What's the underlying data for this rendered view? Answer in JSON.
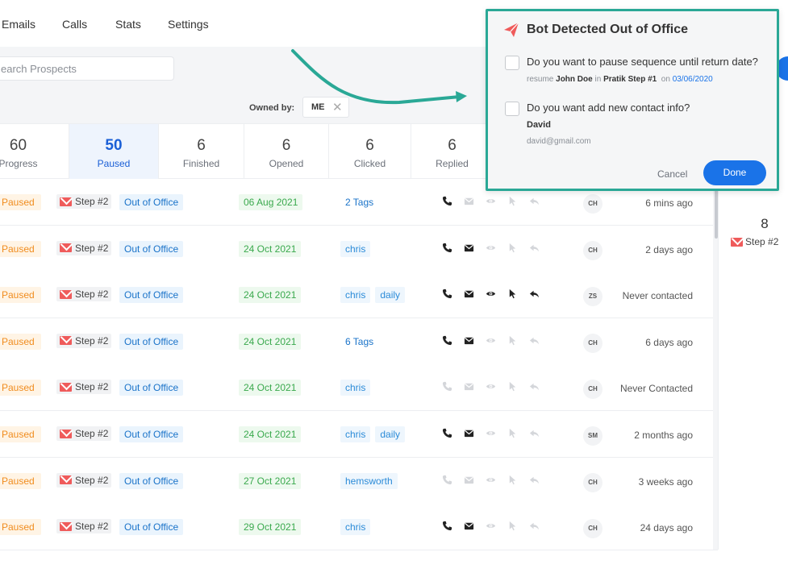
{
  "nav": {
    "items": [
      "Emails",
      "Calls",
      "Stats",
      "Settings"
    ]
  },
  "search": {
    "placeholder": "earch Prospects"
  },
  "owned": {
    "label": "Owned by:",
    "value": "ME",
    "clear_glyph": "✕"
  },
  "stats": [
    {
      "count": "60",
      "label": "Progress"
    },
    {
      "count": "50",
      "label": "Paused"
    },
    {
      "count": "6",
      "label": "Finished"
    },
    {
      "count": "6",
      "label": "Opened"
    },
    {
      "count": "6",
      "label": "Clicked"
    },
    {
      "count": "6",
      "label": "Replied"
    }
  ],
  "rows": [
    {
      "status": "Paused",
      "step": "Step #2",
      "reason": "Out of Office",
      "date": "06 Aug 2021",
      "tags": [
        "2 Tags"
      ],
      "tags_plain": true,
      "icons_active": [
        true,
        false,
        false,
        false,
        false
      ],
      "initials": "CH",
      "last": "6 mins ago"
    },
    {
      "status": "Paused",
      "step": "Step #2",
      "reason": "Out of Office",
      "date": "24 Oct 2021",
      "tags": [
        "chris"
      ],
      "tags_plain": false,
      "icons_active": [
        true,
        true,
        false,
        false,
        false
      ],
      "initials": "CH",
      "last": "2 days ago"
    },
    {
      "status": "Paused",
      "step": "Step #2",
      "reason": "Out of Office",
      "date": "24 Oct 2021",
      "tags": [
        "chris",
        "daily"
      ],
      "tags_plain": false,
      "icons_active": [
        true,
        true,
        true,
        true,
        true
      ],
      "initials": "ZS",
      "last": "Never contacted"
    },
    {
      "status": "Paused",
      "step": "Step #2",
      "reason": "Out of Office",
      "date": "24 Oct 2021",
      "tags": [
        "6 Tags"
      ],
      "tags_plain": true,
      "icons_active": [
        true,
        true,
        false,
        false,
        false
      ],
      "initials": "CH",
      "last": "6 days ago"
    },
    {
      "status": "Paused",
      "step": "Step #2",
      "reason": "Out of Office",
      "date": "24 Oct 2021",
      "tags": [
        "chris"
      ],
      "tags_plain": false,
      "icons_active": [
        false,
        false,
        false,
        false,
        false
      ],
      "initials": "CH",
      "last": "Never Contacted"
    },
    {
      "status": "Paused",
      "step": "Step #2",
      "reason": "Out of Office",
      "date": "24 Oct 2021",
      "tags": [
        "chris",
        "daily"
      ],
      "tags_plain": false,
      "icons_active": [
        true,
        true,
        false,
        false,
        false
      ],
      "initials": "SM",
      "last": "2 months ago"
    },
    {
      "status": "Paused",
      "step": "Step #2",
      "reason": "Out of Office",
      "date": "27 Oct 2021",
      "tags": [
        "hemsworth"
      ],
      "tags_plain": false,
      "icons_active": [
        false,
        false,
        false,
        false,
        false
      ],
      "initials": "CH",
      "last": "3 weeks ago"
    },
    {
      "status": "Paused",
      "step": "Step #2",
      "reason": "Out of Office",
      "date": "29 Oct 2021",
      "tags": [
        "chris"
      ],
      "tags_plain": false,
      "icons_active": [
        true,
        true,
        false,
        false,
        false
      ],
      "initials": "CH",
      "last": "24 days ago"
    }
  ],
  "right_col": {
    "count": "8",
    "step": "Step #2"
  },
  "popup": {
    "title": "Bot Detected Out of Office",
    "q1": "Do you want to pause sequence until return date?",
    "q1_sub_prefix": "resume",
    "q1_sub_name": "John Doe",
    "q1_sub_in": "in",
    "q1_sub_step": "Pratik Step #1",
    "q1_sub_on": "on",
    "q1_sub_date": "03/06/2020",
    "q2": "Do you want add new contact info?",
    "contact_name": "David",
    "contact_email": "david@gmail.com",
    "cancel_label": "Cancel",
    "done_label": "Done"
  },
  "colors": {
    "accent": "#1a73e8",
    "popup_border": "#2aa896",
    "paused": "#f08c1e",
    "date_green": "#3aa94d",
    "step_mail": "#ef5b5b"
  },
  "icon_names": [
    "phone-icon",
    "mail-icon",
    "eye-icon",
    "cursor-icon",
    "reply-icon"
  ]
}
